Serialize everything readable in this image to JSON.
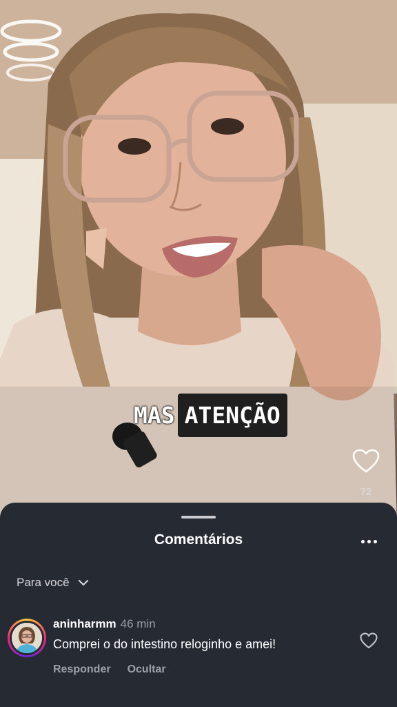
{
  "video": {
    "caption_word_1": "MAS",
    "caption_word_2": "ATENÇÃO",
    "like_count": "72"
  },
  "comments_sheet": {
    "title": "Comentários",
    "filter_label": "Para você",
    "comments": [
      {
        "username": "aninharmm",
        "time": "46 min",
        "text": "Comprei o do intestino reloginho e amei!",
        "reply_label": "Responder",
        "hide_label": "Ocultar"
      }
    ]
  },
  "icons": {
    "more": "more-horizontal-icon",
    "filter_chevron": "chevron-down-icon",
    "like": "heart-outline-icon"
  },
  "colors": {
    "sheet_background": "#262a33",
    "secondary_text": "#9ba0a8",
    "caption_box": "#1f1f1f"
  }
}
